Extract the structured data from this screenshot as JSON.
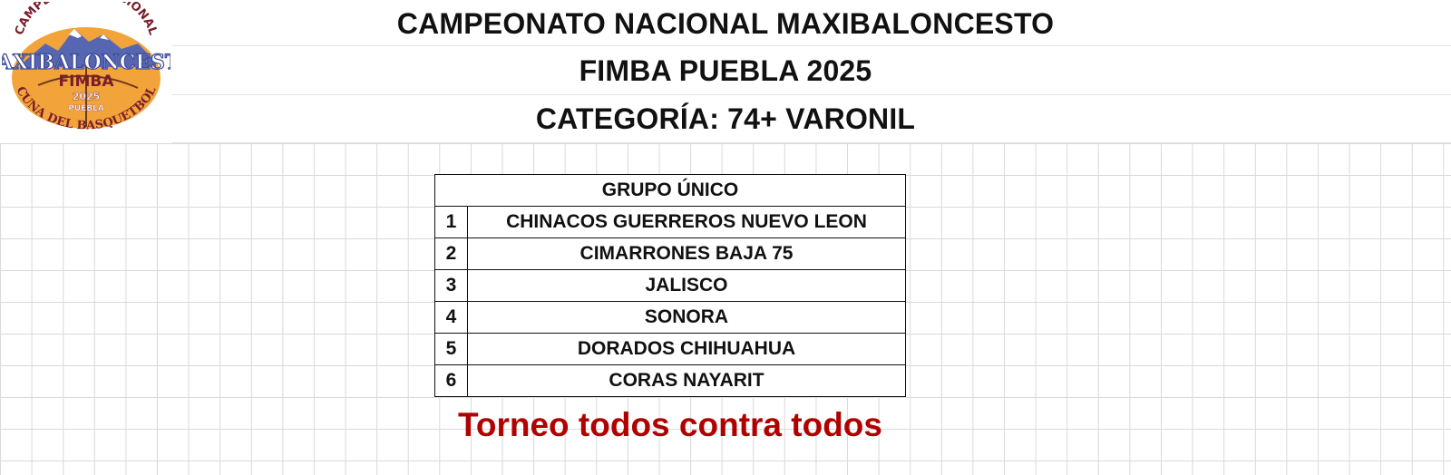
{
  "header": {
    "line1": "CAMPEONATO NACIONAL MAXIBALONCESTO",
    "line2": "FIMBA PUEBLA 2025",
    "line3": "CATEGORÍA:  74+ VARONIL"
  },
  "logo": {
    "icon": "tournament-logo-icon",
    "top_text": "CAMPEONATO NACIONAL",
    "main_text": "MAXIBALONCESTO",
    "org_text": "FIMBA",
    "year_text": "2025",
    "city_text": "PUEBLA",
    "bottom_text": "CUNA DEL BASQUETBOL",
    "colors": {
      "ball": "#f2a33a",
      "text": "#7a1d2b",
      "mountains": "#4a5aa8"
    }
  },
  "group": {
    "title": "GRUPO ÚNICO",
    "teams": [
      {
        "num": "1",
        "name": "CHINACOS GUERREROS NUEVO LEON"
      },
      {
        "num": "2",
        "name": "CIMARRONES BAJA 75"
      },
      {
        "num": "3",
        "name": "JALISCO"
      },
      {
        "num": "4",
        "name": "SONORA"
      },
      {
        "num": "5",
        "name": "DORADOS CHIHUAHUA"
      },
      {
        "num": "6",
        "name": "CORAS NAYARIT"
      }
    ]
  },
  "footer": {
    "text": "Torneo todos contra todos",
    "color": "#b00000"
  }
}
